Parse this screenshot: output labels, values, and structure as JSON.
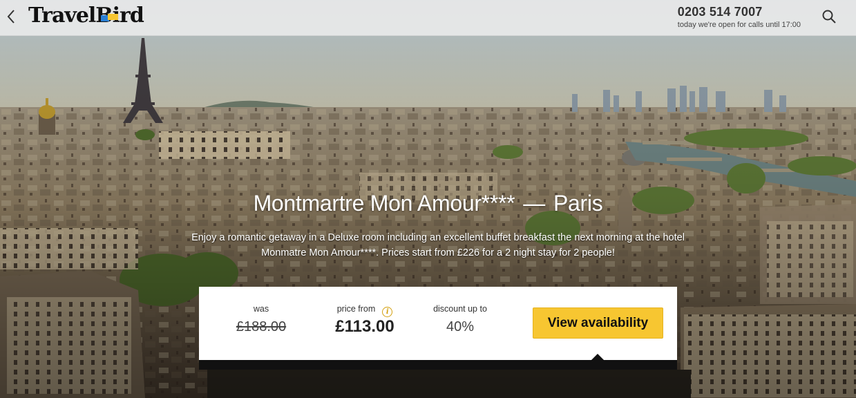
{
  "header": {
    "brand": "TravelBird",
    "phone_number": "0203 514 7007",
    "phone_hours": "today we're open for calls until 17:00",
    "icons": {
      "back": "chevron-left-icon",
      "search": "search-icon"
    }
  },
  "hero": {
    "title_name": "Montmartre Mon Amour****",
    "title_dash": "—",
    "title_city": "Paris",
    "description": "Enjoy a romantic getaway in a Deluxe room including an excellent buffet breakfast the next morning at the hotel Monmatre Mon Amour****. Prices start from £226 for a 2 night stay for 2 people!"
  },
  "pricing": {
    "was_label": "was",
    "was_value": "£188.00",
    "price_label": "price from",
    "price_value": "£113.00",
    "discount_label": "discount up to",
    "discount_value": "40%",
    "cta_label": "View availability"
  },
  "colors": {
    "accent": "#f7c631",
    "header_bg": "#ececec",
    "text_dark": "#111111"
  }
}
